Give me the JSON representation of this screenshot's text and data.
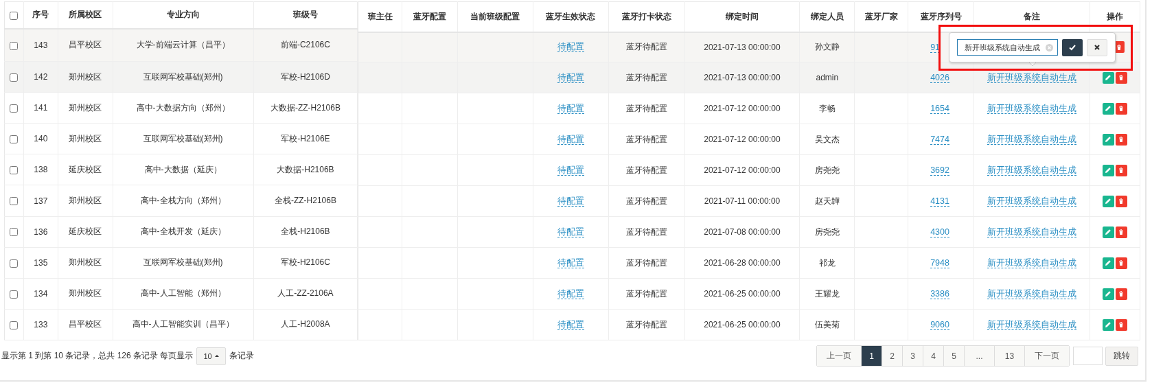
{
  "table": {
    "select_all": {
      "checked": false
    },
    "columns": [
      "序号",
      "所属校区",
      "专业方向",
      "班级号",
      "班主任",
      "蓝牙配置",
      "当前班级配置",
      "蓝牙生效状态",
      "蓝牙打卡状态",
      "绑定时间",
      "绑定人员",
      "蓝牙厂家",
      "蓝牙序列号",
      "备注",
      "操作"
    ],
    "rows": [
      {
        "checked": false,
        "shaded": true,
        "no": "143",
        "campus": "昌平校区",
        "major": "大学-前端云计算（昌平）",
        "class": "前端-C2106C",
        "effect_status": "待配置",
        "punch_status": "蓝牙待配置",
        "bind_time": "2021-07-13 00:00:00",
        "bind_person": "孙文静",
        "serial": "91",
        "actions": [
          {
            "kind": "delete"
          }
        ]
      },
      {
        "checked": false,
        "shaded": true,
        "no": "142",
        "campus": "郑州校区",
        "major": "互联网军校基础(郑州)",
        "class": "军校-H2106D",
        "effect_status": "待配置",
        "punch_status": "蓝牙待配置",
        "bind_time": "2021-07-13 00:00:00",
        "bind_person": "admin",
        "serial": "4026",
        "remark": "新开班级系统自动生成",
        "actions": [
          {
            "kind": "edit"
          },
          {
            "kind": "delete"
          }
        ]
      },
      {
        "checked": false,
        "shaded": false,
        "no": "141",
        "campus": "郑州校区",
        "major": "高中-大数据方向（郑州）",
        "class": "大数据-ZZ-H2106B",
        "effect_status": "待配置",
        "punch_status": "蓝牙待配置",
        "bind_time": "2021-07-12 00:00:00",
        "bind_person": "李畅",
        "serial": "1654",
        "remark": "新开班级系统自动生成",
        "actions": [
          {
            "kind": "edit"
          },
          {
            "kind": "delete"
          }
        ]
      },
      {
        "checked": false,
        "shaded": false,
        "no": "140",
        "campus": "郑州校区",
        "major": "互联网军校基础(郑州)",
        "class": "军校-H2106E",
        "effect_status": "待配置",
        "punch_status": "蓝牙待配置",
        "bind_time": "2021-07-12 00:00:00",
        "bind_person": "吴文杰",
        "serial": "7474",
        "remark": "新开班级系统自动生成",
        "actions": [
          {
            "kind": "edit"
          },
          {
            "kind": "delete"
          }
        ]
      },
      {
        "checked": false,
        "shaded": false,
        "no": "138",
        "campus": "延庆校区",
        "major": "高中-大数据（延庆）",
        "class": "大数据-H2106B",
        "effect_status": "待配置",
        "punch_status": "蓝牙待配置",
        "bind_time": "2021-07-12 00:00:00",
        "bind_person": "房尧尧",
        "serial": "3692",
        "remark": "新开班级系统自动生成",
        "actions": [
          {
            "kind": "edit"
          },
          {
            "kind": "delete"
          }
        ]
      },
      {
        "checked": false,
        "shaded": false,
        "no": "137",
        "campus": "郑州校区",
        "major": "高中-全栈方向（郑州）",
        "class": "全栈-ZZ-H2106B",
        "effect_status": "待配置",
        "punch_status": "蓝牙待配置",
        "bind_time": "2021-07-11 00:00:00",
        "bind_person": "赵天韡",
        "serial": "4131",
        "remark": "新开班级系统自动生成",
        "actions": [
          {
            "kind": "edit"
          },
          {
            "kind": "delete"
          }
        ]
      },
      {
        "checked": false,
        "shaded": false,
        "no": "136",
        "campus": "延庆校区",
        "major": "高中-全栈开发（延庆）",
        "class": "全栈-H2106B",
        "effect_status": "待配置",
        "punch_status": "蓝牙待配置",
        "bind_time": "2021-07-08 00:00:00",
        "bind_person": "房尧尧",
        "serial": "4300",
        "remark": "新开班级系统自动生成",
        "actions": [
          {
            "kind": "edit"
          },
          {
            "kind": "delete"
          }
        ]
      },
      {
        "checked": false,
        "shaded": false,
        "no": "135",
        "campus": "郑州校区",
        "major": "互联网军校基础(郑州)",
        "class": "军校-H2106C",
        "effect_status": "待配置",
        "punch_status": "蓝牙待配置",
        "bind_time": "2021-06-28 00:00:00",
        "bind_person": "祁龙",
        "serial": "7948",
        "remark": "新开班级系统自动生成",
        "actions": [
          {
            "kind": "edit"
          },
          {
            "kind": "delete"
          }
        ]
      },
      {
        "checked": false,
        "shaded": false,
        "no": "134",
        "campus": "郑州校区",
        "major": "高中-人工智能（郑州）",
        "class": "人工-ZZ-2106A",
        "effect_status": "待配置",
        "punch_status": "蓝牙待配置",
        "bind_time": "2021-06-25 00:00:00",
        "bind_person": "王耀龙",
        "serial": "3386",
        "remark": "新开班级系统自动生成",
        "actions": [
          {
            "kind": "edit"
          },
          {
            "kind": "delete"
          }
        ]
      },
      {
        "checked": false,
        "shaded": false,
        "no": "133",
        "campus": "昌平校区",
        "major": "高中-人工智能实训（昌平）",
        "class": "人工-H2008A",
        "effect_status": "待配置",
        "punch_status": "蓝牙待配置",
        "bind_time": "2021-06-25 00:00:00",
        "bind_person": "伍美菊",
        "serial": "9060",
        "remark": "新开班级系统自动生成",
        "actions": [
          {
            "kind": "edit"
          },
          {
            "kind": "delete"
          }
        ]
      }
    ]
  },
  "popover": {
    "value": "新开班级系统自动生成",
    "highlight": true
  },
  "pager": {
    "info": "显示第 1 到第 10 条记录，总共 126 条记录 每页显示",
    "page_size": "10",
    "info_suffix": "条记录",
    "pages": [
      {
        "label": "上一页",
        "selected": false
      },
      {
        "label": "1",
        "selected": true
      },
      {
        "label": "2",
        "selected": false
      },
      {
        "label": "3",
        "selected": false
      },
      {
        "label": "4",
        "selected": false
      },
      {
        "label": "5",
        "selected": false
      },
      {
        "label": "...",
        "selected": false
      },
      {
        "label": "13",
        "selected": false
      },
      {
        "label": "下一页",
        "selected": false
      }
    ],
    "jump_button": "跳转"
  }
}
